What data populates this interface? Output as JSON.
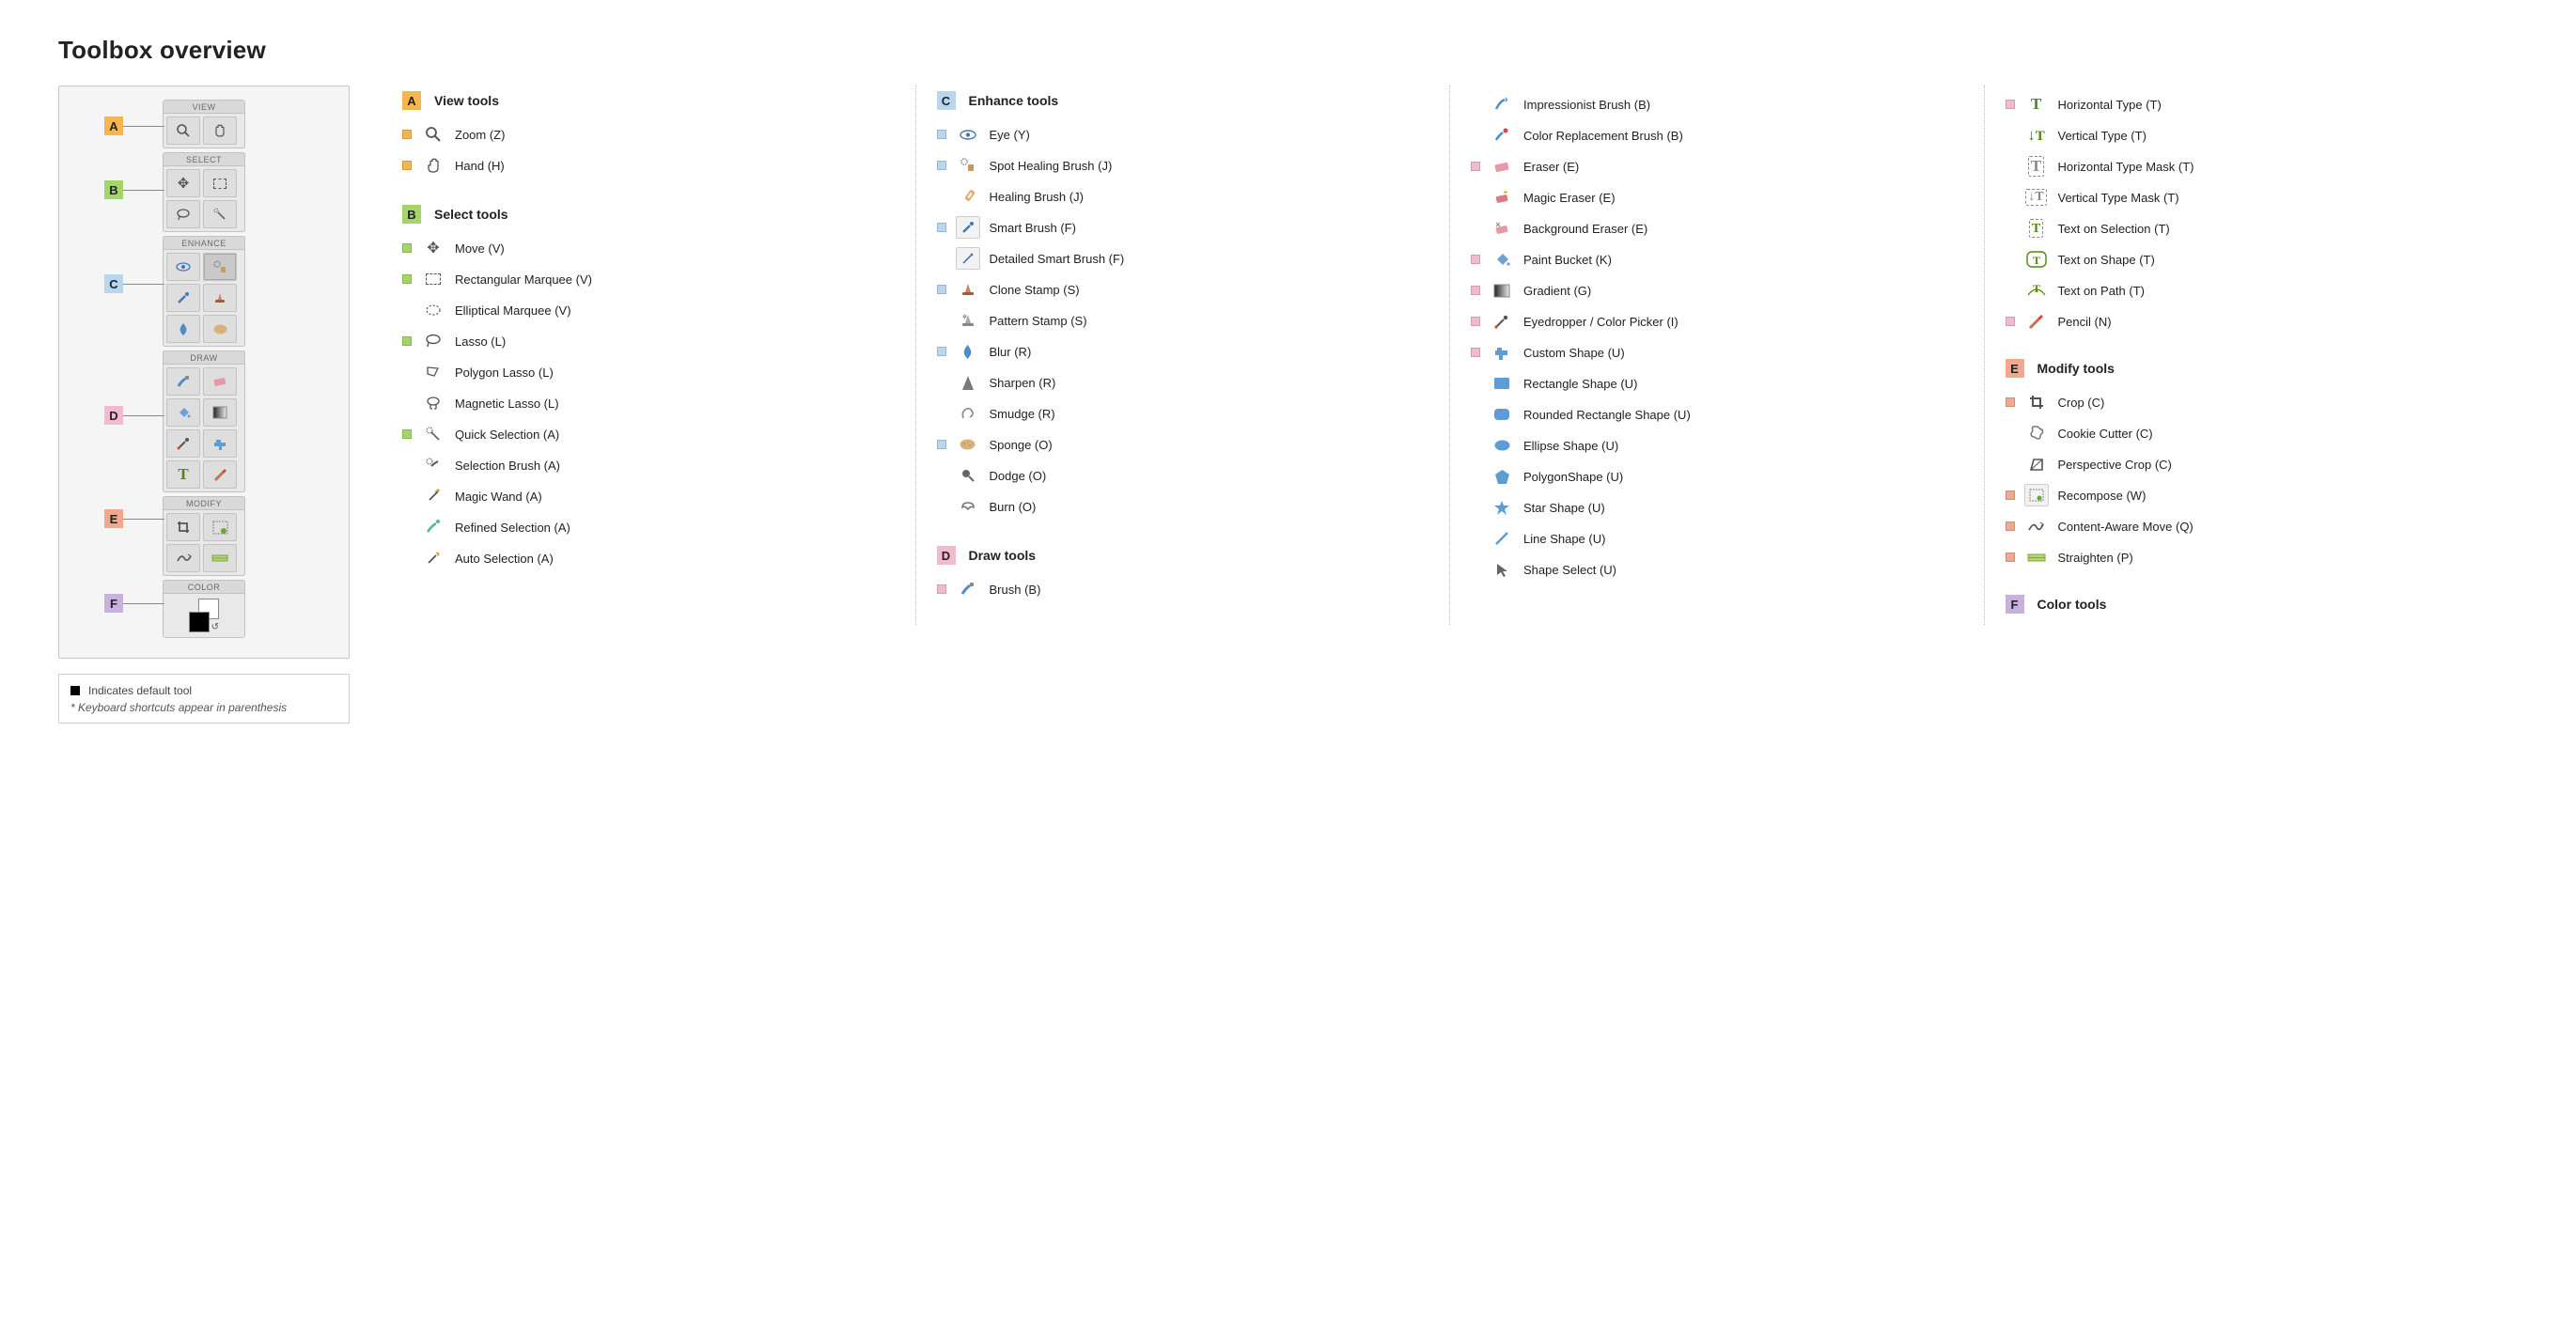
{
  "title": "Toolbox overview",
  "toolbox": {
    "sections": {
      "view": {
        "label": "VIEW"
      },
      "select": {
        "label": "SELECT"
      },
      "enhance": {
        "label": "ENHANCE"
      },
      "draw": {
        "label": "DRAW"
      },
      "modify": {
        "label": "MODIFY"
      },
      "color": {
        "label": "COLOR"
      }
    }
  },
  "callouts": {
    "A": "A",
    "B": "B",
    "C": "C",
    "D": "D",
    "E": "E",
    "F": "F"
  },
  "legend": {
    "default_line": "Indicates default tool",
    "shortcut_line": "* Keyboard shortcuts appear in parenthesis"
  },
  "groups": {
    "A": {
      "title": "View tools",
      "tools": [
        {
          "label": "Zoom (Z)",
          "default": true
        },
        {
          "label": "Hand (H)",
          "default": true
        }
      ]
    },
    "B": {
      "title": "Select tools",
      "tools": [
        {
          "label": "Move (V)",
          "default": true
        },
        {
          "label": "Rectangular Marquee (V)",
          "default": true
        },
        {
          "label": "Elliptical Marquee (V)",
          "default": false
        },
        {
          "label": "Lasso (L)",
          "default": true
        },
        {
          "label": "Polygon Lasso (L)",
          "default": false
        },
        {
          "label": "Magnetic Lasso (L)",
          "default": false
        },
        {
          "label": "Quick Selection  (A)",
          "default": true
        },
        {
          "label": "Selection Brush (A)",
          "default": false
        },
        {
          "label": "Magic Wand (A)",
          "default": false
        },
        {
          "label": "Refined Selection (A)",
          "default": false
        },
        {
          "label": "Auto Selection (A)",
          "default": false
        }
      ]
    },
    "C": {
      "title": "Enhance tools",
      "tools": [
        {
          "label": "Eye (Y)",
          "default": true
        },
        {
          "label": "Spot Healing Brush (J)",
          "default": true
        },
        {
          "label": "Healing Brush (J)",
          "default": false
        },
        {
          "label": "Smart Brush (F)",
          "default": true
        },
        {
          "label": "Detailed Smart Brush (F)",
          "default": false
        },
        {
          "label": "Clone Stamp (S)",
          "default": true
        },
        {
          "label": "Pattern Stamp (S)",
          "default": false
        },
        {
          "label": "Blur (R)",
          "default": true
        },
        {
          "label": "Sharpen (R)",
          "default": false
        },
        {
          "label": "Smudge (R)",
          "default": false
        },
        {
          "label": "Sponge (O)",
          "default": true
        },
        {
          "label": "Dodge (O)",
          "default": false
        },
        {
          "label": "Burn (O)",
          "default": false
        }
      ]
    },
    "D": {
      "title": "Draw tools",
      "tools": [
        {
          "label": "Brush (B)",
          "default": true
        },
        {
          "label": "Impressionist Brush (B)",
          "default": false
        },
        {
          "label": "Color Replacement Brush (B)",
          "default": false
        },
        {
          "label": "Eraser (E)",
          "default": true
        },
        {
          "label": "Magic Eraser (E)",
          "default": false
        },
        {
          "label": "Background Eraser (E)",
          "default": false
        },
        {
          "label": "Paint Bucket (K)",
          "default": true
        },
        {
          "label": "Gradient (G)",
          "default": true
        },
        {
          "label": "Eyedropper / Color Picker (I)",
          "default": true
        },
        {
          "label": "Custom Shape (U)",
          "default": true
        },
        {
          "label": "Rectangle Shape (U)",
          "default": false
        },
        {
          "label": "Rounded Rectangle Shape (U)",
          "default": false
        },
        {
          "label": "Ellipse Shape (U)",
          "default": false
        },
        {
          "label": "PolygonShape (U)",
          "default": false
        },
        {
          "label": "Star Shape (U)",
          "default": false
        },
        {
          "label": "Line Shape (U)",
          "default": false
        },
        {
          "label": "Shape Select (U)",
          "default": false
        },
        {
          "label": "Horizontal Type (T)",
          "default": true
        },
        {
          "label": "Vertical Type (T)",
          "default": false
        },
        {
          "label": "Horizontal Type Mask (T)",
          "default": false
        },
        {
          "label": "Vertical Type Mask (T)",
          "default": false
        },
        {
          "label": "Text on Selection (T)",
          "default": false
        },
        {
          "label": "Text on Shape (T)",
          "default": false
        },
        {
          "label": "Text on Path (T)",
          "default": false
        },
        {
          "label": "Pencil (N)",
          "default": true
        }
      ]
    },
    "E": {
      "title": "Modify tools",
      "tools": [
        {
          "label": "Crop (C)",
          "default": true
        },
        {
          "label": "Cookie Cutter (C)",
          "default": false
        },
        {
          "label": "Perspective Crop (C)",
          "default": false
        },
        {
          "label": "Recompose (W)",
          "default": true
        },
        {
          "label": "Content-Aware Move (Q)",
          "default": true
        },
        {
          "label": "Straighten (P)",
          "default": true
        }
      ]
    },
    "F": {
      "title": "Color tools",
      "tools": []
    }
  }
}
